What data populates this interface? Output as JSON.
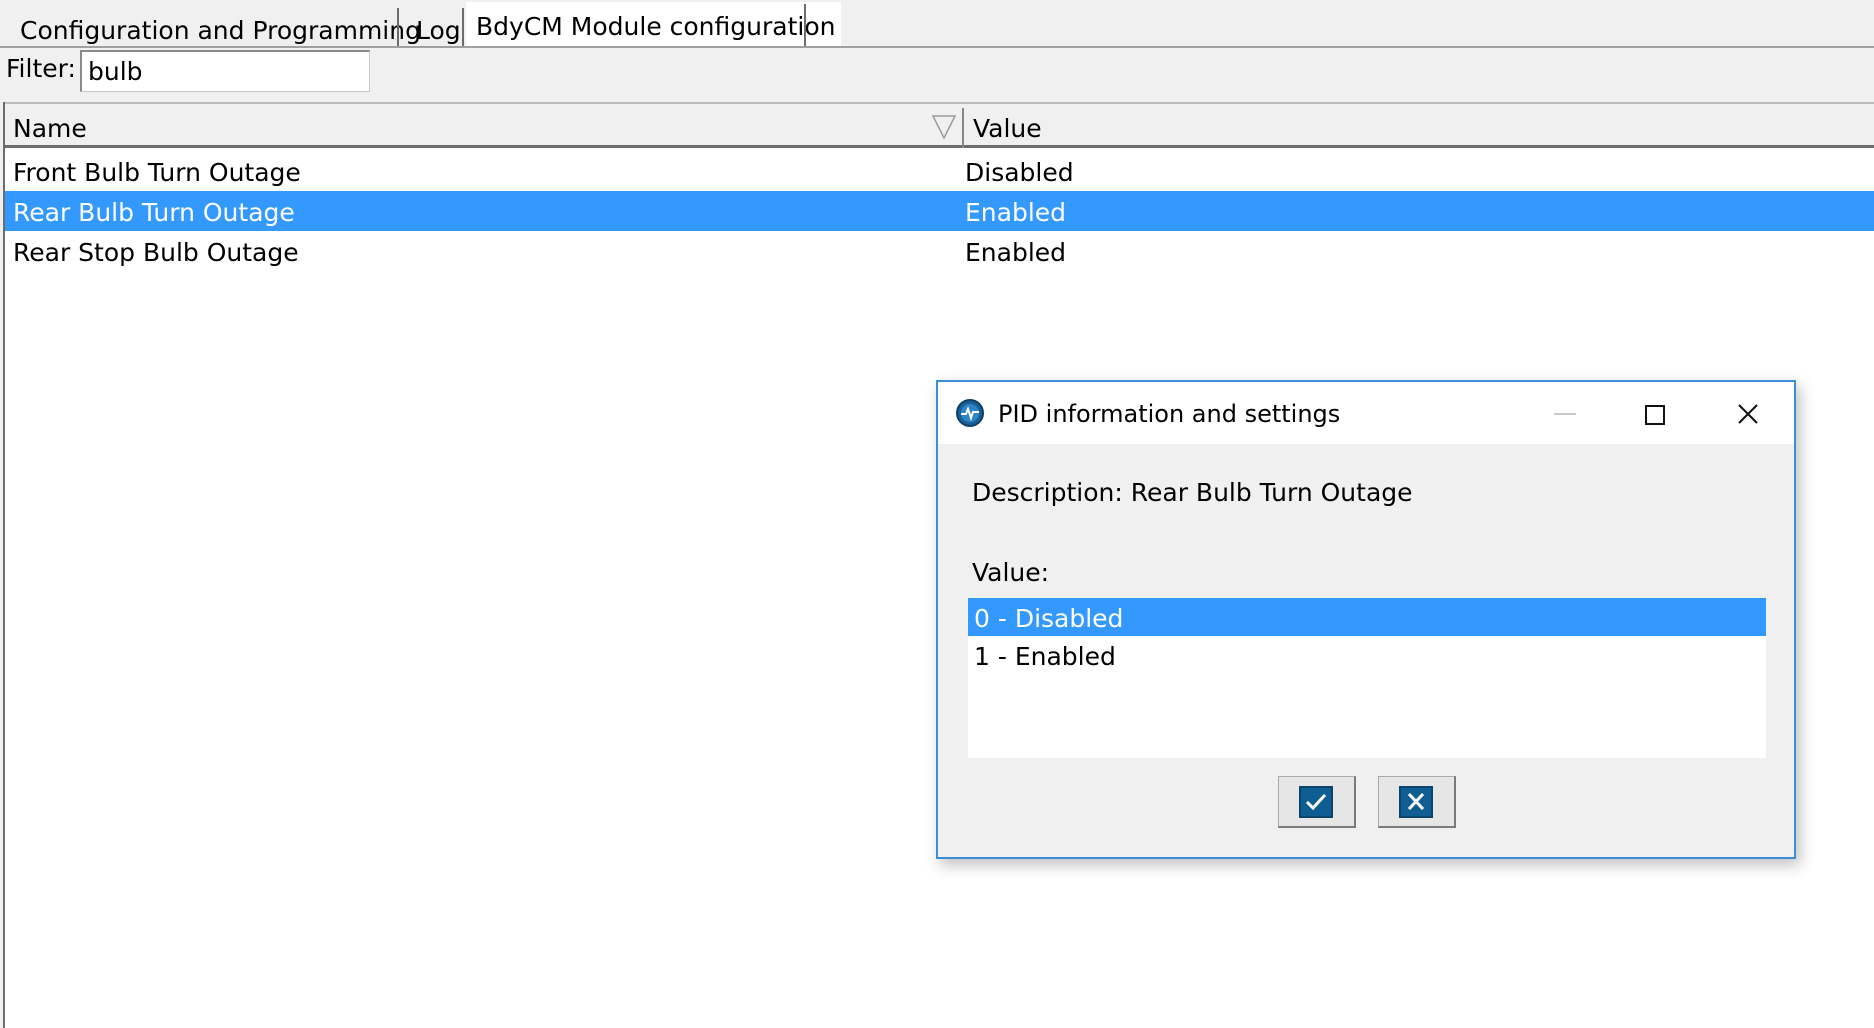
{
  "tabs": [
    {
      "label": "Configuration and Programming",
      "active": false
    },
    {
      "label": "Log",
      "active": false
    },
    {
      "label": "BdyCM Module configuration",
      "active": true
    }
  ],
  "filter": {
    "label": "Filter:",
    "value": "bulb"
  },
  "grid": {
    "columns": [
      "Name",
      "Value"
    ],
    "rows": [
      {
        "name": "Front Bulb Turn Outage",
        "value": "Disabled",
        "selected": false
      },
      {
        "name": "Rear Bulb Turn Outage",
        "value": "Enabled",
        "selected": true
      },
      {
        "name": "Rear Stop Bulb Outage",
        "value": "Enabled",
        "selected": false
      }
    ],
    "sort_icon": "sort-triangle-icon"
  },
  "dialog": {
    "title": "PID information and settings",
    "app_icon": "app-pulse-icon",
    "description": "Description: Rear Bulb Turn Outage",
    "value_label": "Value:",
    "options": [
      {
        "label": "0 - Disabled",
        "selected": true
      },
      {
        "label": "1 - Enabled",
        "selected": false
      }
    ],
    "ok_icon": "checkmark-icon",
    "cancel_icon": "x-icon"
  },
  "colors": {
    "selection": "#3399ff",
    "dialog_border": "#3c8fd6",
    "button_face": "#0f5e93"
  }
}
